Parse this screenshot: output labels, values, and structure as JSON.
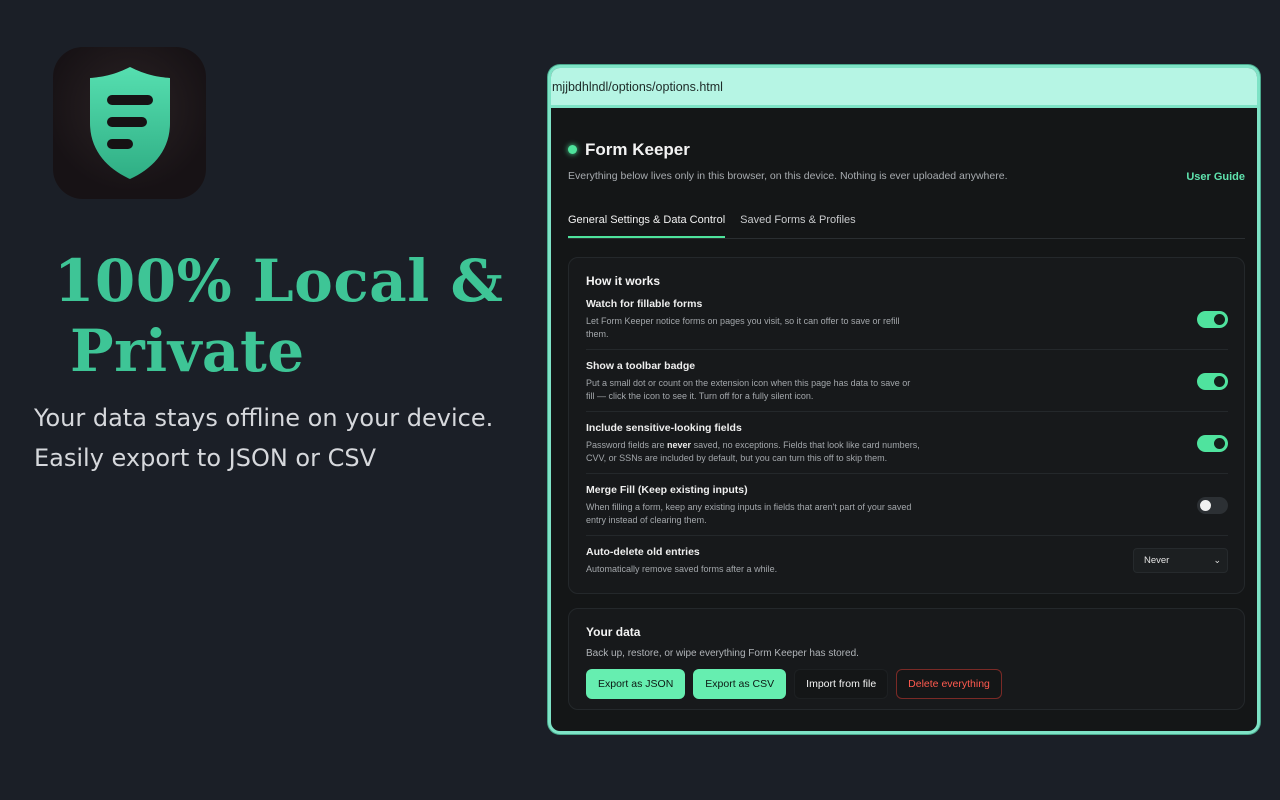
{
  "promo": {
    "headline_line1": "100% Local &",
    "headline_line2": "Private",
    "tagline_line1": "Your data stays offline on your device.",
    "tagline_line2": "Easily export to JSON or CSV"
  },
  "browser": {
    "url": "mjjbdhlndl/options/options.html"
  },
  "header": {
    "title": "Form Keeper",
    "subtitle": "Everything below lives only in this browser, on this device. Nothing is ever uploaded anywhere.",
    "user_guide": "User Guide"
  },
  "tabs": [
    {
      "label": "General Settings & Data Control",
      "active": true
    },
    {
      "label": "Saved Forms & Profiles",
      "active": false
    }
  ],
  "how_it_works": {
    "title": "How it works",
    "settings": [
      {
        "name": "Watch for fillable forms",
        "desc": "Let Form Keeper notice forms on pages you visit, so it can offer to save or refill them.",
        "enabled": true
      },
      {
        "name": "Show a toolbar badge",
        "desc": "Put a small dot or count on the extension icon when this page has data to save or fill — click the icon to see it. Turn off for a fully silent icon.",
        "enabled": true
      },
      {
        "name": "Include sensitive-looking fields",
        "desc_pre": "Password fields are ",
        "desc_bold": "never",
        "desc_post": " saved, no exceptions. Fields that look like card numbers, CVV, or SSNs are included by default, but you can turn this off to skip them.",
        "enabled": true
      },
      {
        "name": "Merge Fill (Keep existing inputs)",
        "desc": "When filling a form, keep any existing inputs in fields that aren't part of your saved entry instead of clearing them.",
        "enabled": false
      },
      {
        "name": "Auto-delete old entries",
        "desc": "Automatically remove saved forms after a while.",
        "select_value": "Never"
      }
    ]
  },
  "your_data": {
    "title": "Your data",
    "desc": "Back up, restore, or wipe everything Form Keeper has stored.",
    "buttons": {
      "export_json": "Export as JSON",
      "export_csv": "Export as CSV",
      "import": "Import from file",
      "delete": "Delete everything"
    }
  },
  "colors": {
    "accent": "#4ee39c",
    "headline": "#3ec596",
    "danger": "#ff5a4f",
    "urlbar": "#b6f5e4"
  },
  "icons": {
    "app": "shield-icon",
    "select": "chevron-down-icon"
  }
}
